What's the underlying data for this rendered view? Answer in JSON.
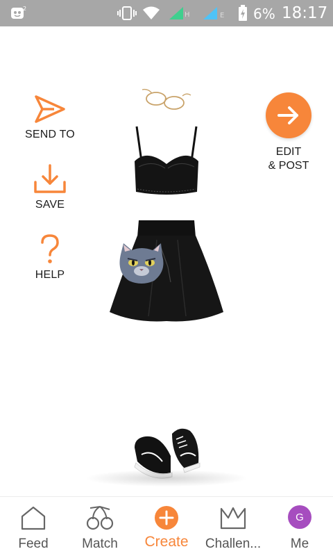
{
  "status_bar": {
    "network_h": "H",
    "network_e": "E",
    "battery_percent": "6%",
    "time": "18:17"
  },
  "actions": {
    "send_to": "SEND TO",
    "save": "SAVE",
    "help": "HELP"
  },
  "edit_post": {
    "line1": "EDIT",
    "line2": "& POST"
  },
  "bottom_nav": {
    "tabs": [
      {
        "label": "Feed",
        "icon": "home-icon"
      },
      {
        "label": "Match",
        "icon": "cherries-icon"
      },
      {
        "label": "Create",
        "icon": "plus-circle-icon"
      },
      {
        "label": "Challen...",
        "icon": "crown-icon"
      },
      {
        "label": "Me",
        "icon": "avatar",
        "avatar_letter": "G"
      }
    ]
  },
  "colors": {
    "accent": "#f7863a",
    "status_bar": "#a7a7a7",
    "avatar": "#a64dbf"
  }
}
